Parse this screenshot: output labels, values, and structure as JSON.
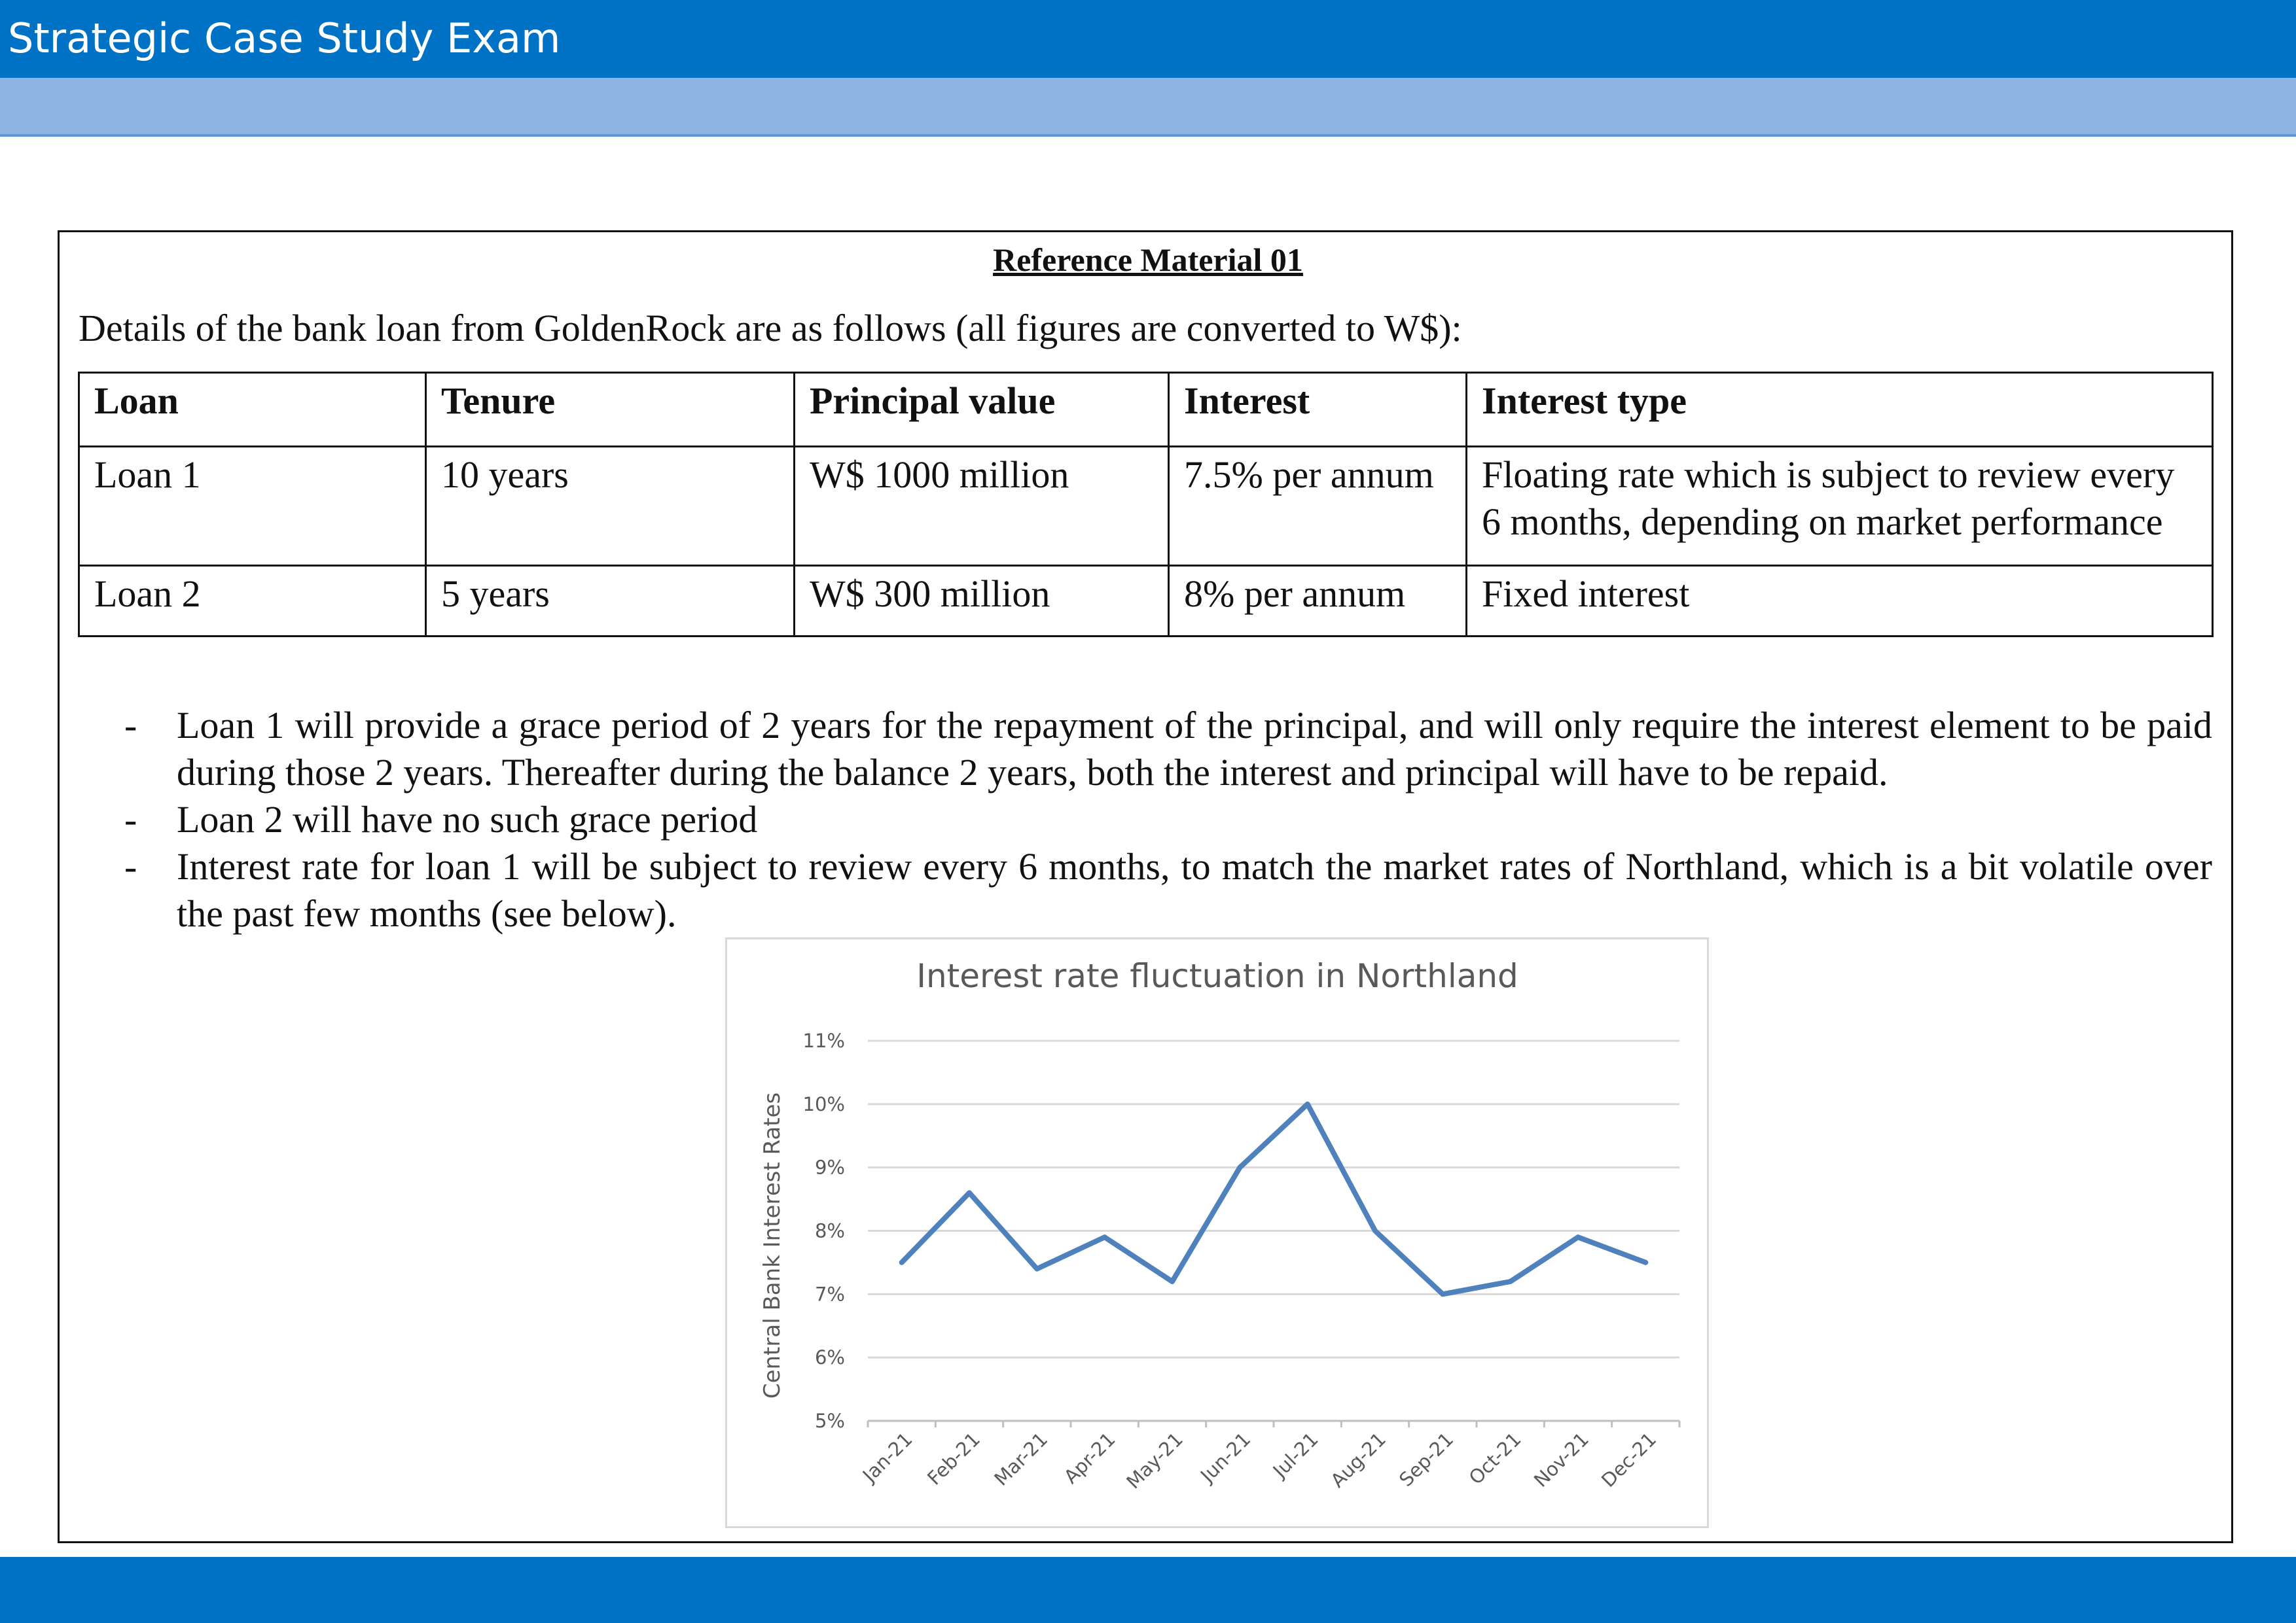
{
  "header": {
    "title": "Strategic Case Study Exam"
  },
  "reference": {
    "heading": "Reference Material 01",
    "intro": "Details of the bank loan from GoldenRock are as follows (all figures are converted to W$):"
  },
  "table": {
    "headers": [
      "Loan",
      "Tenure",
      "Principal value",
      "Interest",
      "Interest type"
    ],
    "rows": [
      [
        "Loan 1",
        "10 years",
        "W$ 1000 million",
        "7.5% per annum",
        "Floating rate which is subject to review every 6 months, depending on market performance"
      ],
      [
        "Loan 2",
        "5 years",
        "W$ 300 million",
        "8% per annum",
        "Fixed interest"
      ]
    ]
  },
  "bullets": {
    "marker": "-",
    "items": [
      "Loan 1 will provide a grace period of 2 years for the repayment of the principal, and will only require the interest element to be paid during those 2 years. Thereafter during the balance 2 years, both the interest and principal will have to be repaid.",
      "Loan 2 will have no such grace period",
      "Interest rate for loan 1 will be subject to review every 6 months, to match the market rates of Northland, which is a bit volatile over the past few months (see below)."
    ]
  },
  "chart_data": {
    "type": "line",
    "title": "Interest rate fluctuation in Northland",
    "xlabel": "",
    "ylabel": "Central Bank Interest Rates",
    "categories": [
      "Jan-21",
      "Feb-21",
      "Mar-21",
      "Apr-21",
      "May-21",
      "Jun-21",
      "Jul-21",
      "Aug-21",
      "Sep-21",
      "Oct-21",
      "Nov-21",
      "Dec-21"
    ],
    "series": [
      {
        "values": [
          7.5,
          8.6,
          7.4,
          7.9,
          7.2,
          9.0,
          10.0,
          8.0,
          7.0,
          7.2,
          7.9,
          7.5
        ]
      }
    ],
    "ylim": [
      5,
      11
    ],
    "yticks": [
      "5%",
      "6%",
      "7%",
      "8%",
      "9%",
      "10%",
      "11%"
    ],
    "grid": true,
    "legend": "none",
    "line_color": "#4f81bd"
  }
}
